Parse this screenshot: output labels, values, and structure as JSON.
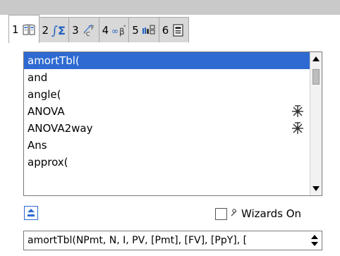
{
  "tabs": [
    {
      "number": "1",
      "icon": "book-icon"
    },
    {
      "number": "2",
      "icon": "integral-sum-icon"
    },
    {
      "number": "3",
      "icon": "unit-conversion-icon"
    },
    {
      "number": "4",
      "icon": "infinity-beta-icon"
    },
    {
      "number": "5",
      "icon": "library-icon"
    },
    {
      "number": "6",
      "icon": "document-icon"
    }
  ],
  "catalog": {
    "items": [
      {
        "label": "amortTbl(",
        "selected": true,
        "wizard": false
      },
      {
        "label": "and",
        "selected": false,
        "wizard": false
      },
      {
        "label": "angle(",
        "selected": false,
        "wizard": false
      },
      {
        "label": "ANOVA",
        "selected": false,
        "wizard": true
      },
      {
        "label": "ANOVA2way",
        "selected": false,
        "wizard": true
      },
      {
        "label": "Ans",
        "selected": false,
        "wizard": false
      },
      {
        "label": "approx(",
        "selected": false,
        "wizard": false
      }
    ]
  },
  "wizards": {
    "label": "Wizards On",
    "checked": false
  },
  "syntax": {
    "text": "amortTbl(NPmt, N, I, PV, [Pmt], [FV], [PpY], ["
  },
  "colors": {
    "selection": "#2e6ad1",
    "tab_bg": "#d8d8d8",
    "bar_bg": "#c9c9c9"
  }
}
